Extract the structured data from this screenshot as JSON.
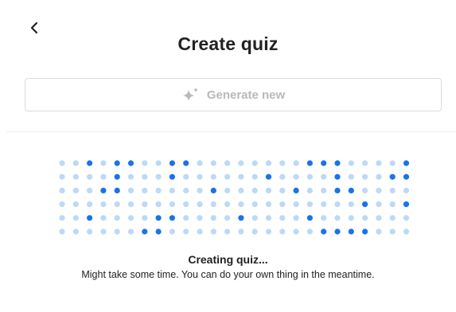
{
  "header": {
    "back_icon": "chevron-left-icon",
    "title": "Create quiz"
  },
  "generate": {
    "icon": "sparkle-icon",
    "label": "Generate new",
    "state": "disabled"
  },
  "loader": {
    "dot_active_color": "#1a73e8",
    "dot_inactive_color": "#bcd9f6",
    "rows": [
      [
        0,
        0,
        1,
        0,
        1,
        1,
        0,
        0,
        1,
        1,
        0,
        0,
        0,
        0,
        0,
        0,
        0,
        0,
        1,
        1,
        1,
        0,
        0,
        0,
        0,
        1
      ],
      [
        0,
        0,
        0,
        0,
        1,
        0,
        0,
        0,
        1,
        0,
        0,
        0,
        0,
        0,
        0,
        1,
        0,
        0,
        0,
        0,
        1,
        0,
        0,
        0,
        1,
        1
      ],
      [
        0,
        0,
        0,
        1,
        1,
        0,
        0,
        0,
        0,
        0,
        0,
        1,
        0,
        0,
        0,
        0,
        0,
        1,
        0,
        0,
        1,
        1,
        0,
        0,
        0,
        0
      ],
      [
        0,
        0,
        0,
        0,
        0,
        0,
        0,
        0,
        0,
        0,
        0,
        0,
        0,
        0,
        0,
        0,
        0,
        0,
        0,
        0,
        0,
        0,
        1,
        0,
        0,
        1,
        0
      ],
      [
        0,
        0,
        1,
        0,
        0,
        0,
        0,
        1,
        1,
        0,
        0,
        0,
        0,
        1,
        0,
        0,
        0,
        0,
        1,
        0,
        0,
        0,
        0,
        0,
        0,
        0
      ],
      [
        0,
        0,
        0,
        0,
        0,
        0,
        1,
        1,
        0,
        0,
        0,
        0,
        0,
        0,
        0,
        0,
        0,
        0,
        0,
        1,
        1,
        1,
        1,
        0,
        0,
        0
      ]
    ]
  },
  "status": {
    "title": "Creating quiz...",
    "subtitle": "Might take some time. You can do your own thing in the meantime."
  }
}
